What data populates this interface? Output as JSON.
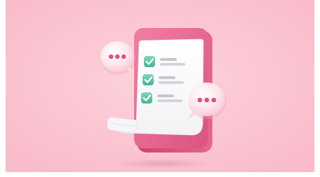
{
  "illustration": {
    "subject": "checklist-document",
    "checklist": {
      "items": [
        {
          "checked": true
        },
        {
          "checked": true
        },
        {
          "checked": true
        }
      ],
      "check_color": "#5ec3a5"
    },
    "speech_bubbles": [
      {
        "side": "left",
        "dots": 3
      },
      {
        "side": "right",
        "dots": 3
      }
    ],
    "colors": {
      "background": "#fcc6d2",
      "tablet": "#e3668a",
      "paper": "#ffffff",
      "bubble": "#fde1e7",
      "dots": "#e94a79",
      "lines": "#c9c9d0"
    }
  }
}
